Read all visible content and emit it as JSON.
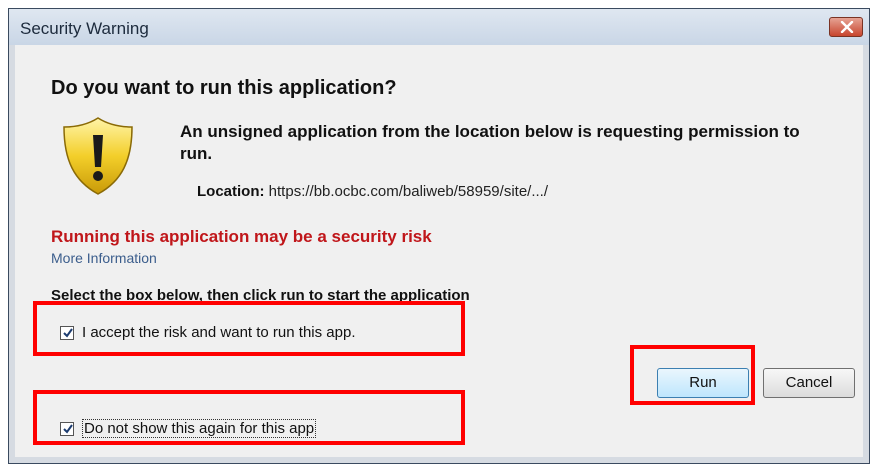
{
  "window": {
    "title": "Security Warning"
  },
  "dialog": {
    "heading": "Do you want to run this application?",
    "message": "An unsigned application from the location below is requesting permission to run.",
    "location_label": "Location:",
    "location_value": "https://bb.ocbc.com/baliweb/58959/site/.../",
    "risk_text": "Running this application may be a security risk",
    "more_info": "More Information",
    "instruction": "Select the box below, then click run to start the application",
    "checkbox_accept": {
      "label": "I accept the risk and want to run this app.",
      "checked": true
    },
    "checkbox_dont_show": {
      "label": "Do not show this again for this app",
      "checked": true
    },
    "run_label": "Run",
    "cancel_label": "Cancel"
  },
  "icons": [
    "close-icon",
    "warning-shield-icon",
    "checkmark-icon"
  ],
  "colors": {
    "risk": "#c0161a",
    "highlight": "#ff0000",
    "link": "#3b5d8c"
  }
}
